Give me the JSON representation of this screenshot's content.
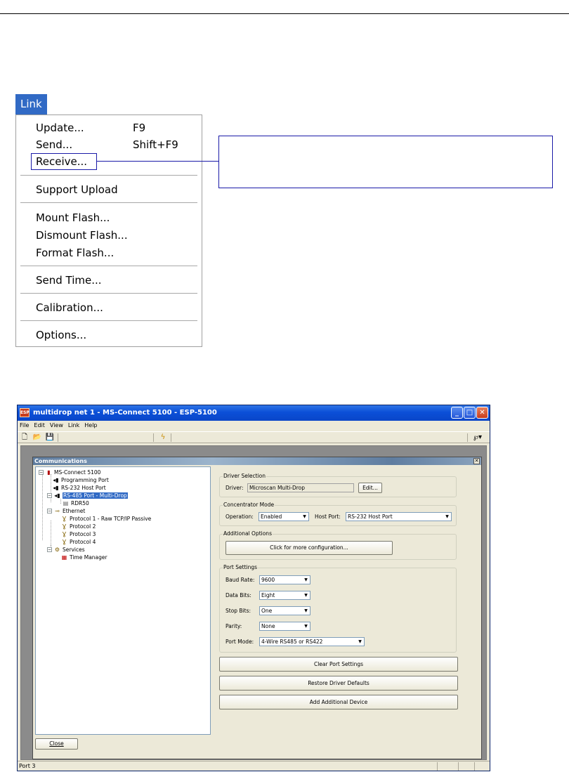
{
  "menu": {
    "title": "Link",
    "items": [
      {
        "label": "Update...",
        "shortcut": "F9"
      },
      {
        "label": "Send...",
        "shortcut": "Shift+F9"
      },
      {
        "label": "Receive...",
        "shortcut": ""
      },
      {
        "label": "Support Upload",
        "shortcut": ""
      },
      {
        "label": "Mount Flash...",
        "shortcut": ""
      },
      {
        "label": "Dismount Flash...",
        "shortcut": ""
      },
      {
        "label": "Format Flash...",
        "shortcut": ""
      },
      {
        "label": "Send Time...",
        "shortcut": ""
      },
      {
        "label": "Calibration...",
        "shortcut": ""
      },
      {
        "label": "Options...",
        "shortcut": ""
      }
    ]
  },
  "window": {
    "title": "multidrop net 1 - MS-Connect 5100 - ESP-5100",
    "icon_text": "ESP",
    "menubar": [
      "File",
      "Edit",
      "View",
      "Link",
      "Help"
    ],
    "child_title": "Communications",
    "tree": [
      {
        "label": "MS-Connect 5100",
        "icon": "device-icon"
      },
      {
        "label": "Programming Port",
        "icon": "port-icon"
      },
      {
        "label": "RS-232 Host Port",
        "icon": "port-icon"
      },
      {
        "label": "RS-485 Port - Multi-Drop",
        "icon": "port-icon"
      },
      {
        "label": "RDR50",
        "icon": "reader-icon"
      },
      {
        "label": "Ethernet",
        "icon": "network-icon"
      },
      {
        "label": "Protocol 1 - Raw TCP/IP Passive",
        "icon": "protocol-icon"
      },
      {
        "label": "Protocol 2",
        "icon": "protocol-icon"
      },
      {
        "label": "Protocol 3",
        "icon": "protocol-icon"
      },
      {
        "label": "Protocol 4",
        "icon": "protocol-icon"
      },
      {
        "label": "Services",
        "icon": "services-icon"
      },
      {
        "label": "Time Manager",
        "icon": "clock-icon"
      }
    ],
    "driver_selection": {
      "title": "Driver Selection",
      "driver_label": "Driver:",
      "driver_value": "Microscan Multi-Drop",
      "edit_button": "Edit..."
    },
    "concentrator": {
      "title": "Concentrator Mode",
      "operation_label": "Operation:",
      "operation_value": "Enabled",
      "host_port_label": "Host Port:",
      "host_port_value": "RS-232 Host Port"
    },
    "additional_options": {
      "title": "Additional Options",
      "button": "Click for more configuration..."
    },
    "port_settings": {
      "title": "Port Settings",
      "baud_label": "Baud Rate:",
      "baud_value": "9600",
      "data_bits_label": "Data Bits:",
      "data_bits_value": "Eight",
      "stop_bits_label": "Stop Bits:",
      "stop_bits_value": "One",
      "parity_label": "Parity:",
      "parity_value": "None",
      "port_mode_label": "Port Mode:",
      "port_mode_value": "4-Wire RS485 or RS422"
    },
    "buttons": {
      "clear": "Clear Port Settings",
      "restore": "Restore Driver Defaults",
      "add": "Add Additional Device",
      "close": "Close"
    },
    "status": "Port 3"
  }
}
